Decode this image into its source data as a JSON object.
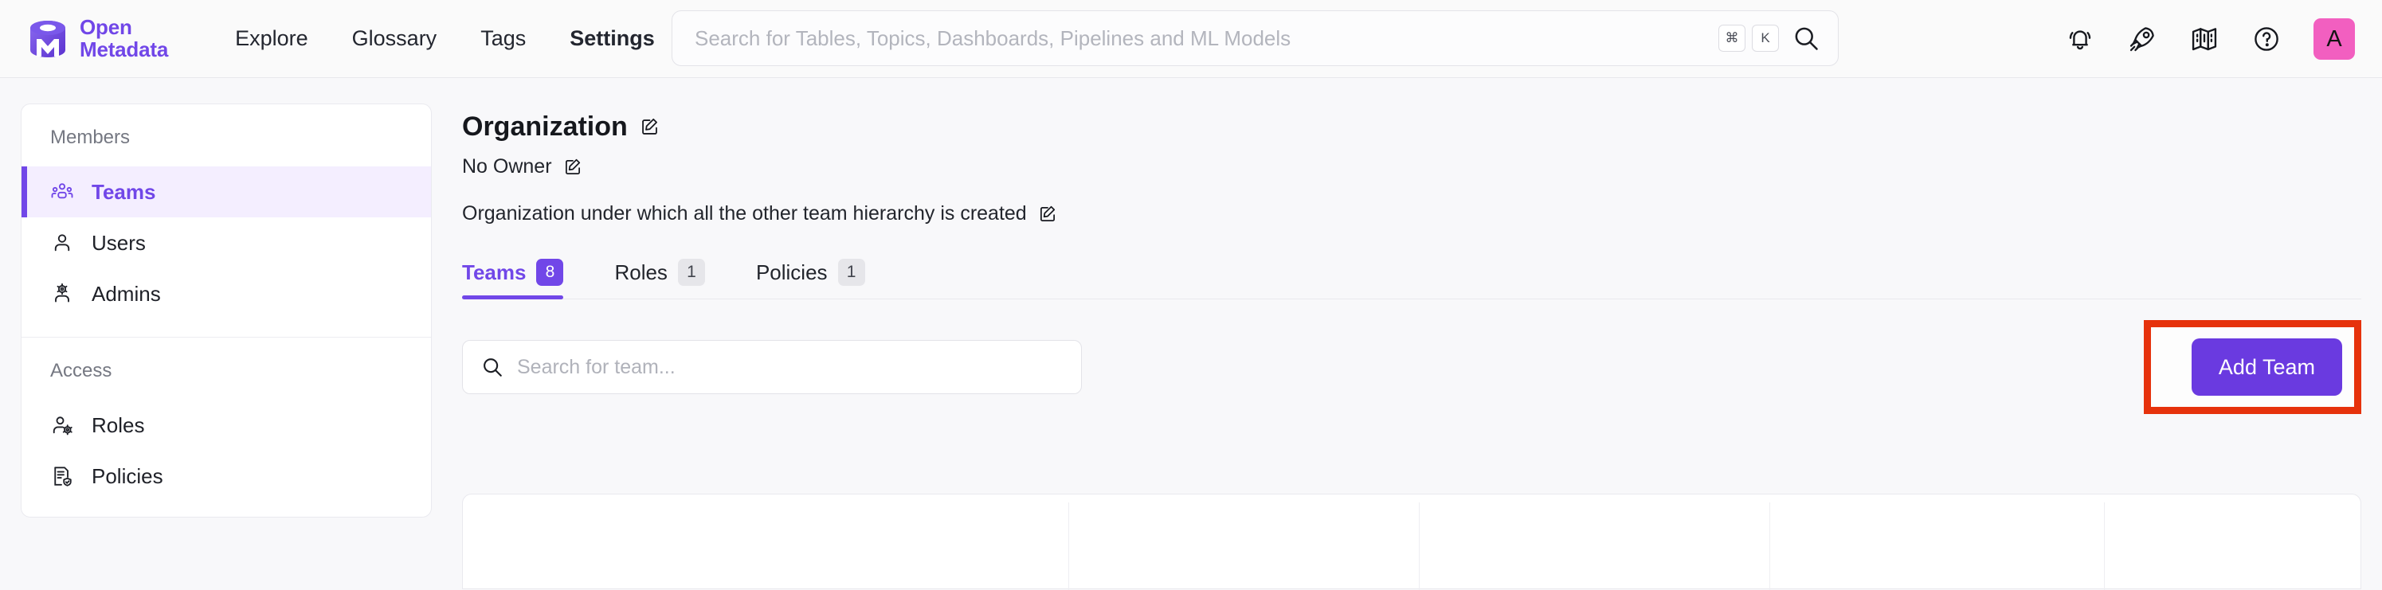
{
  "brand": {
    "line1": "Open",
    "line2": "Metadata",
    "logo_icon": "openmetadata-logo-icon",
    "color": "#7147e8"
  },
  "topnav": {
    "links": [
      {
        "label": "Explore",
        "name": "nav-explore",
        "active": false
      },
      {
        "label": "Glossary",
        "name": "nav-glossary",
        "active": false
      },
      {
        "label": "Tags",
        "name": "nav-tags",
        "active": false
      },
      {
        "label": "Settings",
        "name": "nav-settings",
        "active": true
      }
    ],
    "search": {
      "placeholder": "Search for Tables, Topics, Dashboards, Pipelines and ML Models",
      "value": "",
      "shortcut_key1": "⌘",
      "shortcut_key2": "K",
      "search_icon": "search-icon"
    },
    "icons": [
      {
        "name": "notification-bell-icon",
        "glyph": "bell"
      },
      {
        "name": "rocket-icon",
        "glyph": "rocket"
      },
      {
        "name": "tour-map-icon",
        "glyph": "map"
      },
      {
        "name": "help-icon",
        "glyph": "question-circle"
      }
    ],
    "avatar": {
      "initial": "A",
      "color": "#f25fc0"
    }
  },
  "sidebar": {
    "groups": [
      {
        "label": "Members",
        "items": [
          {
            "label": "Teams",
            "icon": "teams-icon",
            "active": true
          },
          {
            "label": "Users",
            "icon": "user-icon",
            "active": false
          },
          {
            "label": "Admins",
            "icon": "admin-gear-user-icon",
            "active": false
          }
        ]
      },
      {
        "label": "Access",
        "items": [
          {
            "label": "Roles",
            "icon": "roles-user-gear-icon",
            "active": false
          },
          {
            "label": "Policies",
            "icon": "policies-document-shield-icon",
            "active": false
          }
        ]
      }
    ]
  },
  "main": {
    "title": "Organization",
    "title_edit_icon": "edit-pencil-icon",
    "owner": "No Owner",
    "owner_edit_icon": "edit-pencil-icon",
    "description": "Organization under which all the other team hierarchy is created",
    "description_edit_icon": "edit-pencil-icon",
    "tabs": [
      {
        "label": "Teams",
        "count": "8",
        "active": true
      },
      {
        "label": "Roles",
        "count": "1",
        "active": false
      },
      {
        "label": "Policies",
        "count": "1",
        "active": false
      }
    ],
    "team_search": {
      "placeholder": "Search for team...",
      "value": "",
      "search_icon": "search-icon"
    },
    "add_team_label": "Add Team",
    "add_team_color": "#6a3ae0",
    "highlight_color": "#e6320c"
  }
}
